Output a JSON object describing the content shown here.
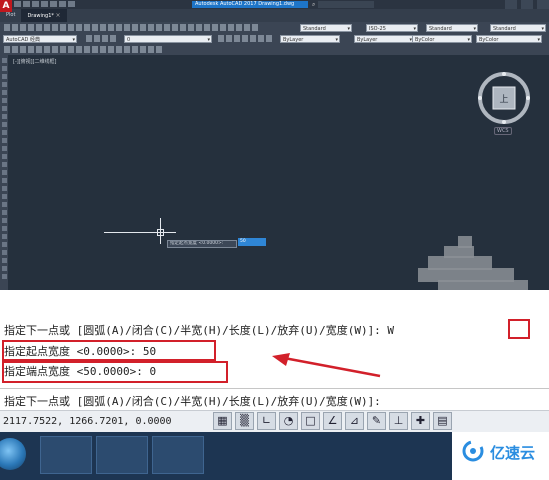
{
  "app": {
    "logo_letter": "A",
    "title": "Autodesk AutoCAD 2017  Drawing1.dwg"
  },
  "tabs": [
    {
      "label": "Plot"
    },
    {
      "label": "Drawing1*",
      "active": true
    }
  ],
  "toolbar": {
    "workspace": "AutoCAD 经典",
    "text_style": "Standard",
    "dim_style": "ISO-25",
    "table_style": "Standard",
    "multileader_style": "Standard",
    "layer": "0",
    "color": "ByLayer",
    "linetype": "ByLayer",
    "lineweight": "ByColor"
  },
  "viewport": {
    "label": "[-][俯视][二维线框]",
    "viewcube_face": "上",
    "wcs": "WCS"
  },
  "dynamic_input": {
    "prompt": "指定起点宽度 <0.0000>:",
    "value": "50"
  },
  "command_history": {
    "line1": "指定下一点或 [圆弧(A)/闭合(C)/半宽(H)/长度(L)/放弃(U)/宽度(W)]: W",
    "line2": "指定起点宽度 <0.0000>: 50",
    "line3": "指定端点宽度 <50.0000>: 0",
    "prompt_line": "指定下一点或 [圆弧(A)/闭合(C)/半宽(H)/长度(L)/放弃(U)/宽度(W)]:"
  },
  "status_bar": {
    "coordinates": "2117.7522, 1266.7201, 0.0000",
    "icons": [
      "model-space-icon",
      "grid-icon",
      "ortho-icon",
      "polar-icon",
      "osnap-icon",
      "otrack-icon",
      "dynamic-ucs-icon",
      "dynamic-input-icon",
      "lineweight-icon",
      "crosshair-icon",
      "calculator-icon"
    ]
  },
  "watermark": {
    "text": "亿速云",
    "color": "#2a8de0"
  },
  "colors": {
    "canvas": "#25303d",
    "highlight": "#d2202a",
    "accent": "#1e75c8"
  }
}
